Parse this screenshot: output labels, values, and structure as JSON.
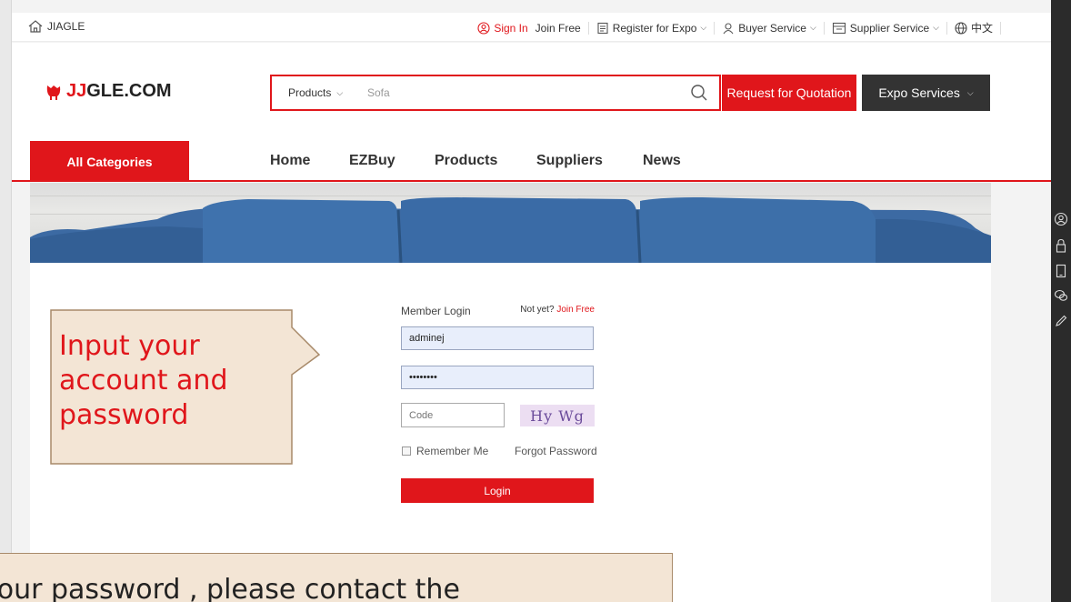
{
  "topbar": {
    "home_label": "JIAGLE",
    "sign_in": "Sign In",
    "join_free": "Join Free",
    "register_expo": "Register for Expo",
    "buyer_service": "Buyer Service",
    "supplier_service": "Supplier Service",
    "language": "中文"
  },
  "header": {
    "logo_prefix": "JJ",
    "logo_suffix": "GLE.COM",
    "search_category": "Products",
    "search_value": "Sofa",
    "rfq_label": "Request for Quotation",
    "expo_label": "Expo Services"
  },
  "nav": {
    "all_categories": "All Categories",
    "links": [
      "Home",
      "EZBuy",
      "Products",
      "Suppliers",
      "News"
    ]
  },
  "login": {
    "title": "Member Login",
    "not_yet": "Not yet?",
    "join_free": "Join Free",
    "username": "adminej",
    "password": "••••••••",
    "code_placeholder": "Code",
    "captcha_text": "Hy Wg",
    "remember_me": "Remember Me",
    "forgot_password": "Forgot Password",
    "login_button": "Login"
  },
  "callouts": {
    "account_hint": "Input your account and password",
    "password_hint": "your password , please contact the"
  },
  "colors": {
    "accent": "#e0161b",
    "dark": "#333333",
    "callout_bg": "#f3e5d5",
    "callout_border": "#a88a6a"
  }
}
